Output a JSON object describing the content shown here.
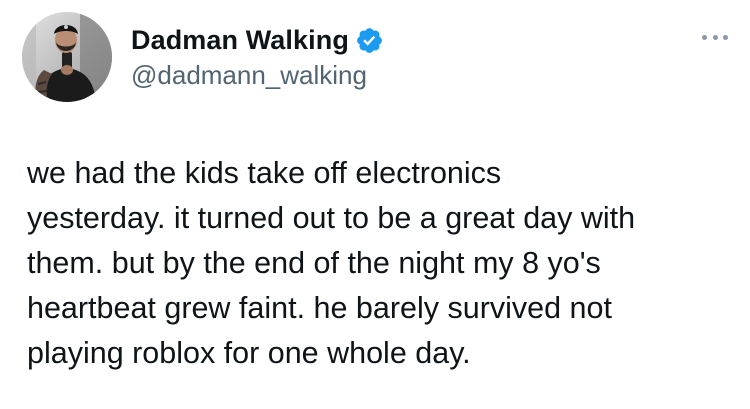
{
  "author": {
    "display_name": "Dadman Walking",
    "handle": "@dadmann_walking",
    "verified": true,
    "verified_color": "#1d9bf0",
    "avatar_icon": "profile-photo"
  },
  "header": {
    "more_icon": "more-horizontal-icon"
  },
  "tweet": {
    "lines": [
      "we had the kids take off electronics",
      "yesterday. it turned out to be a great day with",
      "them. but by the end of the night my 8 yo's",
      "heartbeat grew faint. he barely survived not",
      "playing roblox for one whole day."
    ]
  },
  "colors": {
    "text_primary": "#0f1419",
    "text_secondary": "#536471",
    "background": "#ffffff"
  }
}
